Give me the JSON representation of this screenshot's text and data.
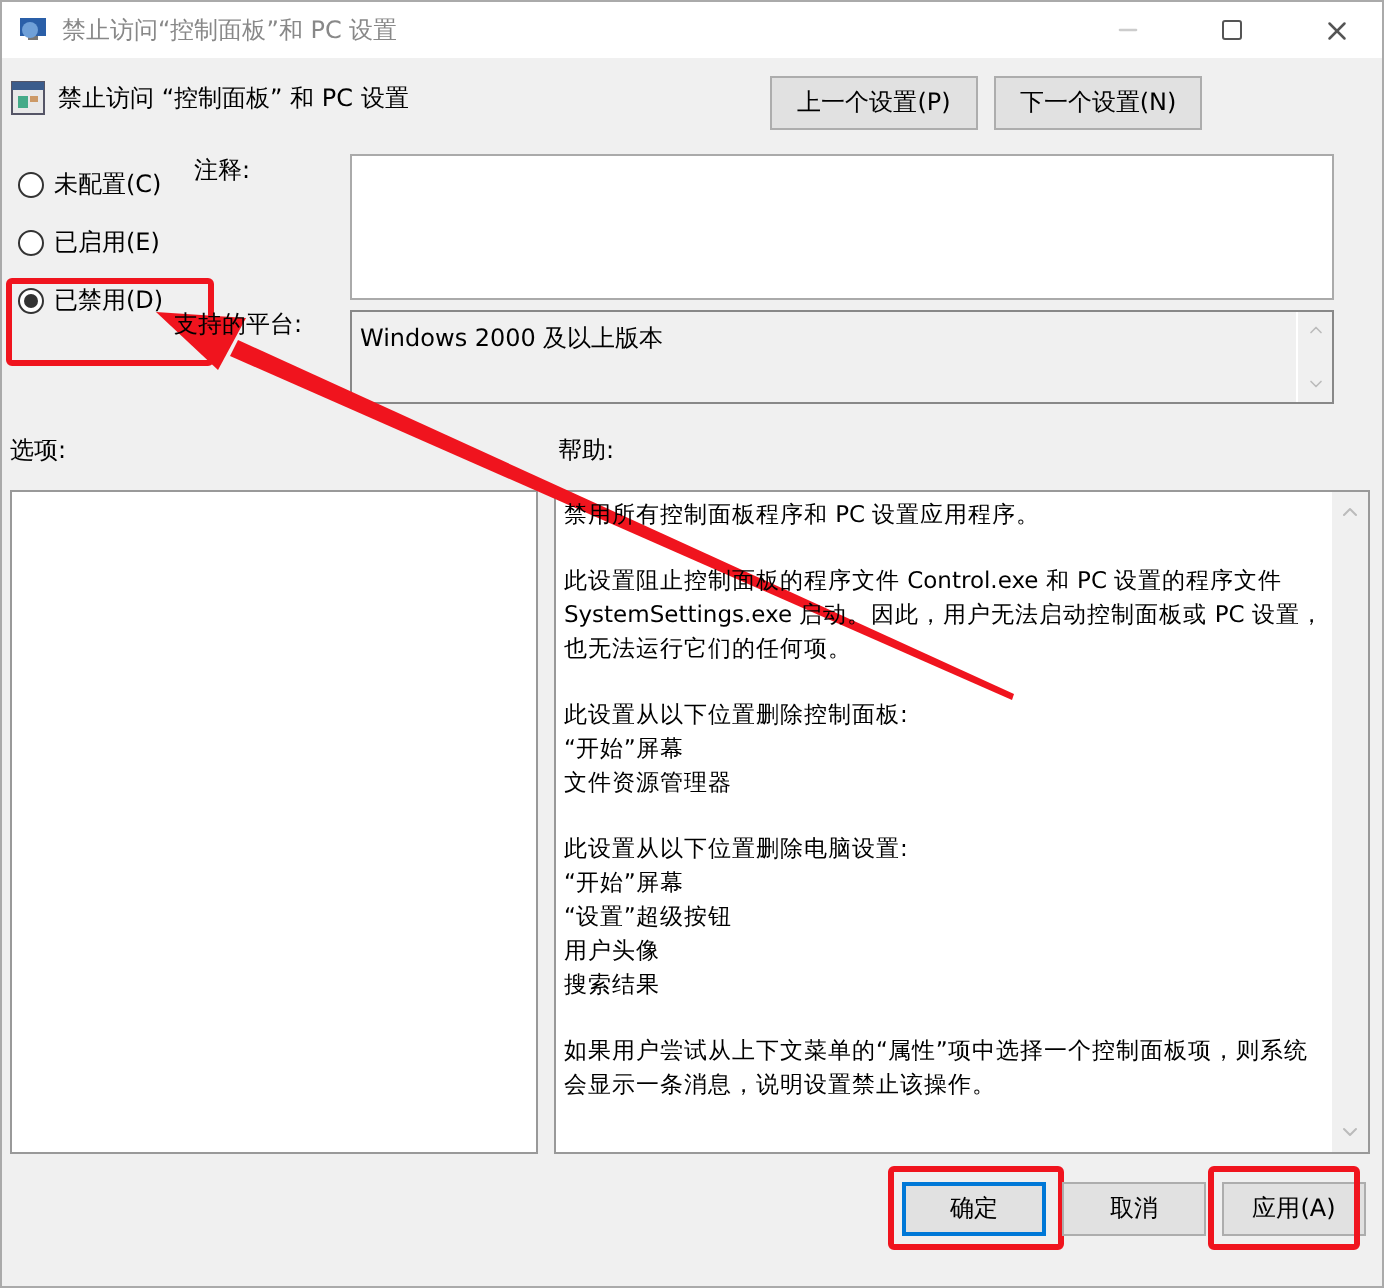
{
  "window": {
    "title": "禁止访问“控制面板”和 PC 设置"
  },
  "header": {
    "title": "禁止访问 “控制面板” 和 PC 设置",
    "buttons": [
      "上一个设置(P)",
      "下一个设置(N)"
    ]
  },
  "state_options": [
    {
      "label": "未配置(C)",
      "selected": false,
      "highlighted": false
    },
    {
      "label": "已启用(E)",
      "selected": false,
      "highlighted": false
    },
    {
      "label": "已禁用(D)",
      "selected": true,
      "highlighted": true
    }
  ],
  "comment": {
    "label": "注释:"
  },
  "platform": {
    "label": "支持的平台:",
    "value": "Windows 2000 及以上版本"
  },
  "options": {
    "label": "选项:"
  },
  "help": {
    "label": "帮助:",
    "paragraphs": [
      [
        "禁用所有控制面板程序和 PC 设置应用程序。"
      ],
      [
        "此设置阻止控制面板的程序文件 Control.exe 和 PC 设置的程序文件",
        "SystemSettings.exe 启动。因此，用户无法启动控制面板或 PC 设置，",
        "也无法运行它们的任何项。"
      ],
      [
        "此设置从以下位置删除控制面板:",
        "“开始”屏幕",
        "文件资源管理器"
      ],
      [
        "此设置从以下位置删除电脑设置:",
        "“开始”屏幕",
        "“设置”超级按钮",
        "用户头像",
        "搜索结果"
      ],
      [
        "如果用户尝试从上下文菜单的“属性”项中选择一个控制面板项，则系统",
        "会显示一条消息，说明设置禁止该操作。"
      ]
    ]
  },
  "footer_buttons": [
    {
      "label": "确定",
      "default": true,
      "highlighted": true
    },
    {
      "label": "取消",
      "default": false,
      "highlighted": false
    },
    {
      "label": "应用(A)",
      "default": false,
      "highlighted": true
    }
  ],
  "pointer_arrow": true
}
